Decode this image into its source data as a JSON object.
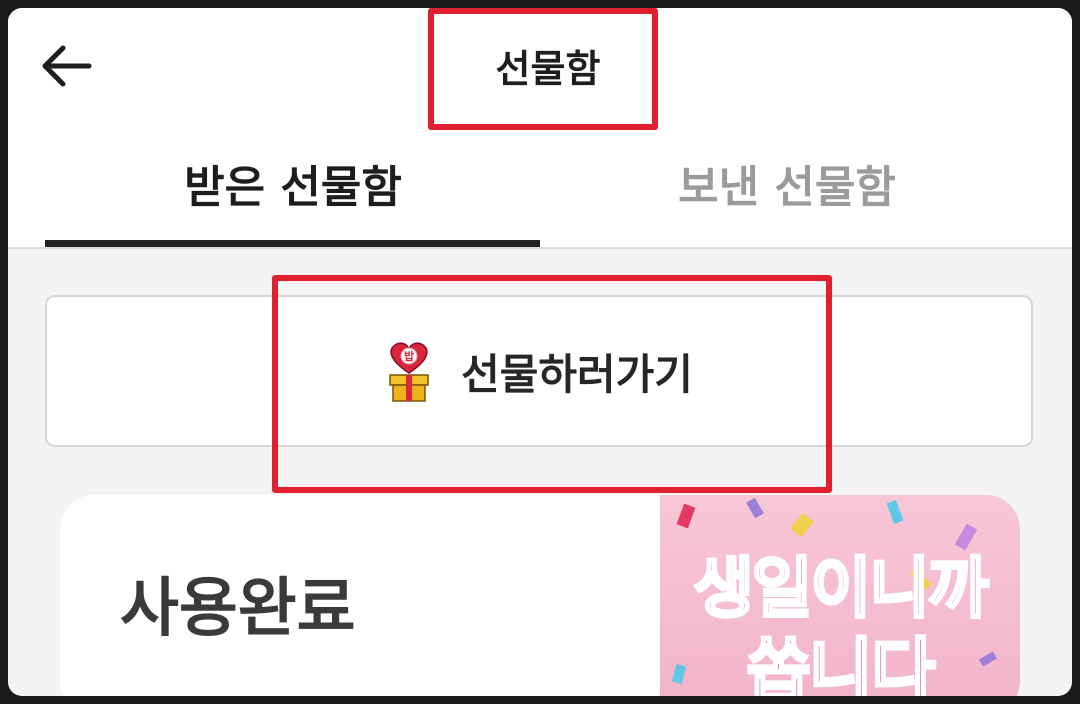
{
  "header": {
    "title": "선물함"
  },
  "tabs": [
    {
      "label": "받은 선물함",
      "active": true
    },
    {
      "label": "보낸 선물함",
      "active": false
    }
  ],
  "gift_button": {
    "label": "선물하러가기",
    "icon_text": "밥"
  },
  "card": {
    "status": "사용완료",
    "banner_line1": "생일이니까",
    "banner_line2": "쏩니다"
  },
  "colors": {
    "highlight": "#e0202e",
    "banner_text": "#e23a63",
    "banner_bg": "#f5bdd0"
  }
}
